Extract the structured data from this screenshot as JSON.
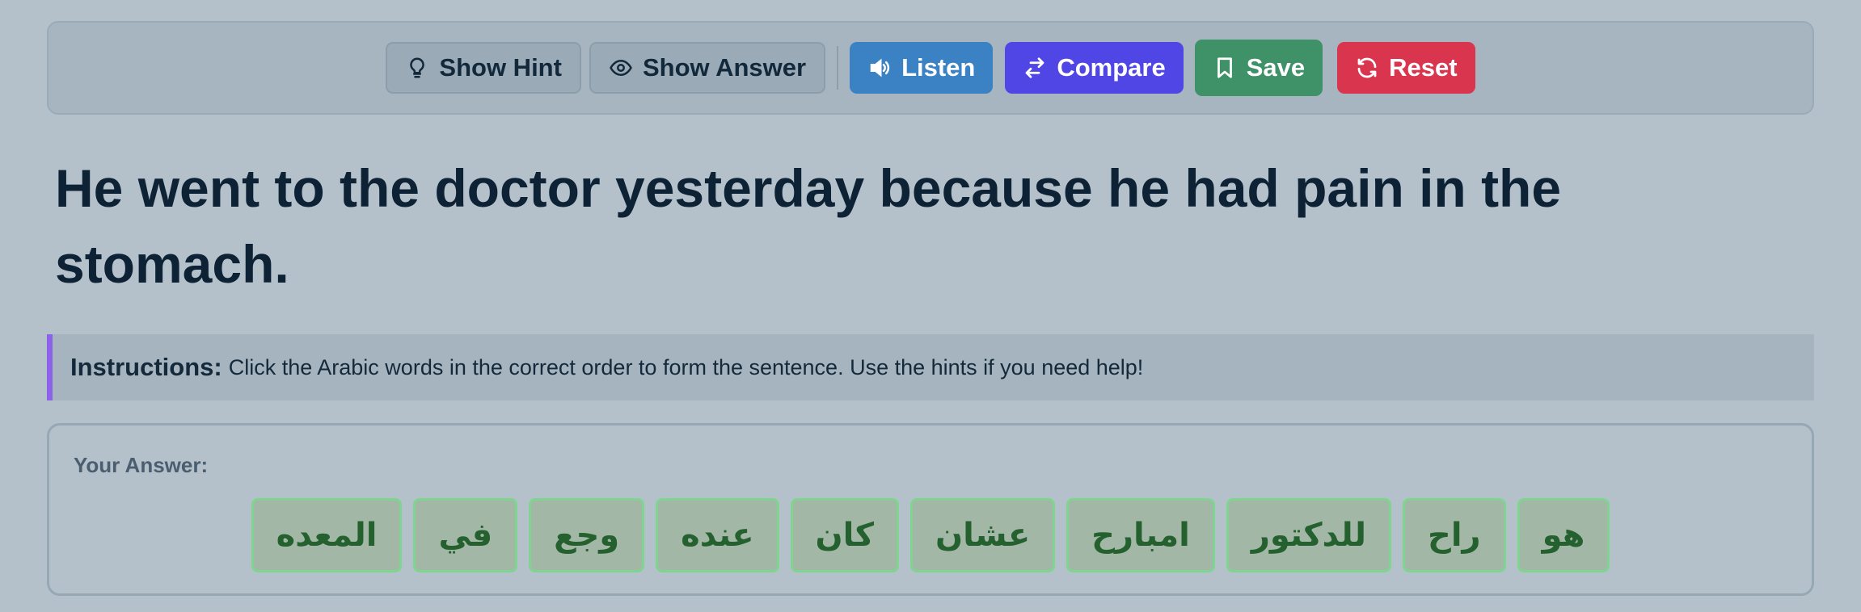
{
  "toolbar": {
    "hint": {
      "label": "Show Hint",
      "icon": "lightbulb-icon"
    },
    "answer": {
      "label": "Show Answer",
      "icon": "eye-icon"
    },
    "listen": {
      "label": "Listen",
      "icon": "speaker-icon",
      "color": "#3b82c4"
    },
    "compare": {
      "label": "Compare",
      "icon": "swap-arrows-icon",
      "color": "#4f46e5"
    },
    "save": {
      "label": "Save",
      "icon": "bookmark-icon",
      "color": "#3f9167"
    },
    "reset": {
      "label": "Reset",
      "icon": "refresh-icon",
      "color": "#d9354e"
    }
  },
  "sentence": "He went to the doctor yesterday because he had pain in the stomach.",
  "instructions": {
    "label": "Instructions:",
    "text": "Click the Arabic words in the correct order to form the sentence. Use the hints if you need help!",
    "accent_color": "#8b62e8"
  },
  "answer": {
    "label": "Your Answer:",
    "words": [
      "المعده",
      "في",
      "وجع",
      "عنده",
      "كان",
      "عشان",
      "امبارح",
      "للدكتور",
      "راح",
      "هو"
    ]
  }
}
